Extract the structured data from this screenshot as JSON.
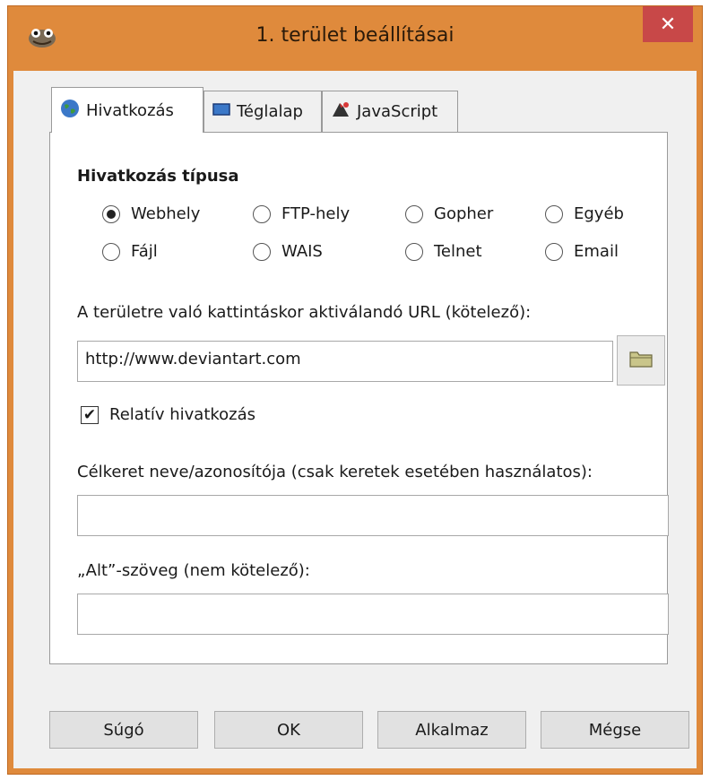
{
  "window": {
    "title": "1. terület beállításai",
    "close_label": "✕"
  },
  "tabs": [
    {
      "icon": "globe-icon",
      "label": "Hivatkozás",
      "active": true
    },
    {
      "icon": "rectangle-icon",
      "label": "Téglalap",
      "active": false
    },
    {
      "icon": "javascript-icon",
      "label": "JavaScript",
      "active": false
    }
  ],
  "link_type": {
    "title": "Hivatkozás típusa",
    "options": [
      {
        "label": "Webhely",
        "selected": true
      },
      {
        "label": "FTP-hely",
        "selected": false
      },
      {
        "label": "Gopher",
        "selected": false
      },
      {
        "label": "Egyéb",
        "selected": false
      },
      {
        "label": "Fájl",
        "selected": false
      },
      {
        "label": "WAIS",
        "selected": false
      },
      {
        "label": "Telnet",
        "selected": false
      },
      {
        "label": "Email",
        "selected": false
      }
    ]
  },
  "url": {
    "label": "A területre való kattintáskor aktiválandó URL (kötelező):",
    "value": "http://www.deviantart.com"
  },
  "relative": {
    "label": "Relatív hivatkozás",
    "checked": true
  },
  "target_frame": {
    "label": "Célkeret neve/azonosítója (csak keretek esetében használatos):",
    "value": ""
  },
  "alt_text": {
    "label": "„Alt”-szöveg (nem kötelező):",
    "value": ""
  },
  "buttons": {
    "help": "Súgó",
    "ok": "OK",
    "apply": "Alkalmaz",
    "cancel": "Mégse"
  },
  "colors": {
    "frame": "#df8a3c",
    "close": "#c84848"
  }
}
